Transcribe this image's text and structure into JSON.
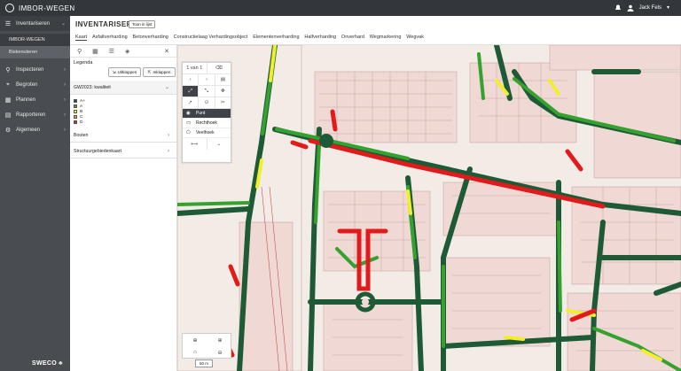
{
  "topbar": {
    "app_title": "IMBOR-WEGEN",
    "user_name": "Jack Fels"
  },
  "sidebar": {
    "items": [
      {
        "label": "Inventariseren",
        "icon": "list-icon"
      },
      {
        "label": "Inspecteren",
        "icon": "search-icon"
      },
      {
        "label": "Begroten",
        "icon": "map-pin-icon"
      },
      {
        "label": "Plannen",
        "icon": "calendar-icon"
      },
      {
        "label": "Rapporteren",
        "icon": "report-icon"
      },
      {
        "label": "Algemeen",
        "icon": "gear-icon"
      }
    ],
    "sub_items": [
      {
        "label": "IMBOR-WEGEN"
      },
      {
        "label": "Biskenuteren"
      }
    ],
    "brand": "SWECO"
  },
  "header": {
    "title": "INVENTARISEREN",
    "toon_button": "Toon in lijst",
    "tabs": [
      "Kaart",
      "Asfaltverharding",
      "Betonverharding",
      "Constructielaag Verhardingsobject",
      "Elementenverharding",
      "Halfverharding",
      "Onverhard",
      "Wegmarkering",
      "Wegvak"
    ]
  },
  "panel": {
    "legend_title": "Legenda",
    "btn_uitklappen": "Uitklappen",
    "btn_inklappen": "Inklappen",
    "sections": [
      "GW2023: kwaliteit",
      "Bouten",
      "Structuurgebiedenkaart"
    ],
    "legend": [
      {
        "label": "A+",
        "color": "#1b5e3a"
      },
      {
        "label": "A",
        "color": "#3d9a3d"
      },
      {
        "label": "B",
        "color": "#f3ef2a"
      },
      {
        "label": "C",
        "color": "#f0902a"
      },
      {
        "label": "D",
        "color": "#e02020"
      }
    ]
  },
  "maptools": {
    "page": "1 van 1",
    "options": [
      "Punt",
      "Rechthoek",
      "Veelhoek"
    ]
  },
  "scale": "50 m",
  "colors": {
    "topbar": "#33373b",
    "sidebar": "#494d52",
    "road_dark": "#1e5a36",
    "road_green": "#35a12f",
    "road_yellow": "#f2ee2c",
    "road_red": "#e11b1b"
  }
}
